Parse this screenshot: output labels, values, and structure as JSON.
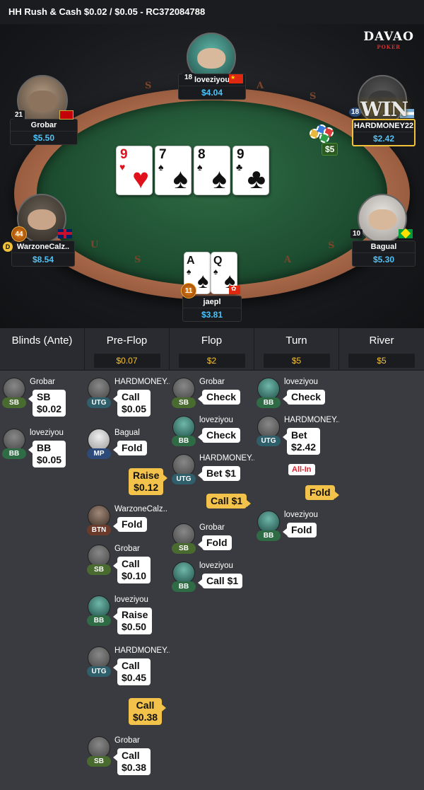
{
  "header": {
    "title": "HH  Rush & Cash $0.02 / $0.05   - RC372084788"
  },
  "logo": {
    "line1": "DAVAO",
    "line2": "POKER"
  },
  "rail_letters": [
    "S",
    "A",
    "S",
    "U",
    "S",
    "A",
    "S"
  ],
  "board": [
    {
      "rank": "9",
      "suit": "♥",
      "color": "red"
    },
    {
      "rank": "7",
      "suit": "♠",
      "color": "blk"
    },
    {
      "rank": "8",
      "suit": "♠",
      "color": "blk"
    },
    {
      "rank": "9",
      "suit": "♣",
      "color": "blk"
    }
  ],
  "hero_cards": [
    {
      "rank": "A",
      "suit": "♠",
      "color": "blk"
    },
    {
      "rank": "Q",
      "suit": "♠",
      "color": "blk"
    }
  ],
  "seats": {
    "top": {
      "name": "loveziyou",
      "stack": "$4.04",
      "level": "18",
      "flag": "cn"
    },
    "left_top": {
      "name": "Grobar",
      "stack": "$5.50",
      "level": "21",
      "flag": "me"
    },
    "right_top": {
      "name": "HARDMONEY22",
      "stack": "$2.42",
      "level": "18",
      "flag": "ar",
      "win": "WIN",
      "bet": "$5"
    },
    "left_bottom": {
      "name": "WarzoneCalz..",
      "stack": "$8.54",
      "level": "44",
      "flag": "gb"
    },
    "right_bottom": {
      "name": "Bagual",
      "stack": "$5.30",
      "level": "10",
      "flag": "br"
    },
    "hero": {
      "name": "jaepl",
      "stack": "$3.81",
      "level": "11",
      "flag": "hk"
    }
  },
  "columns": [
    {
      "title": "Blinds (Ante)",
      "pot": ""
    },
    {
      "title": "Pre-Flop",
      "pot": "$0.07"
    },
    {
      "title": "Flop",
      "pot": "$2"
    },
    {
      "title": "Turn",
      "pot": "$5"
    },
    {
      "title": "River",
      "pot": "$5"
    }
  ],
  "actions": {
    "blinds": [
      {
        "name": "Grobar",
        "pos": "SB",
        "action": "SB",
        "amount": "$0.02"
      },
      {
        "name": "loveziyou",
        "pos": "BB",
        "action": "BB",
        "amount": "$0.05"
      }
    ],
    "preflop": [
      {
        "name": "HARDMONEY..",
        "pos": "UTG",
        "action": "Call",
        "amount": "$0.05"
      },
      {
        "name": "Bagual",
        "pos": "MP",
        "action": "Fold",
        "amount": ""
      },
      {
        "name": "WarzoneCalz..",
        "pos": "BTN",
        "action": "Fold",
        "amount": ""
      },
      {
        "name": "Grobar",
        "pos": "SB",
        "action": "Call",
        "amount": "$0.10"
      },
      {
        "name": "loveziyou",
        "pos": "BB",
        "action": "Raise",
        "amount": "$0.50"
      },
      {
        "name": "HARDMONEY..",
        "pos": "UTG",
        "action": "Call",
        "amount": "$0.45"
      },
      {
        "name": "Grobar",
        "pos": "SB",
        "action": "Call",
        "amount": "$0.38"
      }
    ],
    "preflop_hero": [
      {
        "action": "Raise",
        "amount": "$0.12"
      },
      {
        "action": "Call",
        "amount": "$0.38"
      }
    ],
    "flop": [
      {
        "name": "Grobar",
        "pos": "SB",
        "action": "Check",
        "amount": ""
      },
      {
        "name": "loveziyou",
        "pos": "BB",
        "action": "Check",
        "amount": ""
      },
      {
        "name": "HARDMONEY..",
        "pos": "UTG",
        "action": "Bet $1",
        "amount": ""
      },
      {
        "name": "Grobar",
        "pos": "SB",
        "action": "Fold",
        "amount": ""
      },
      {
        "name": "loveziyou",
        "pos": "BB",
        "action": "Call $1",
        "amount": ""
      }
    ],
    "flop_hero": {
      "action": "Call $1"
    },
    "turn": [
      {
        "name": "loveziyou",
        "pos": "BB",
        "action": "Check",
        "amount": ""
      },
      {
        "name": "HARDMONEY..",
        "pos": "UTG",
        "action": "Bet",
        "amount": "$2.42",
        "badge": "All-In"
      },
      {
        "name": "loveziyou",
        "pos": "BB",
        "action": "Fold",
        "amount": ""
      }
    ],
    "turn_hero": {
      "action": "Fold"
    }
  }
}
